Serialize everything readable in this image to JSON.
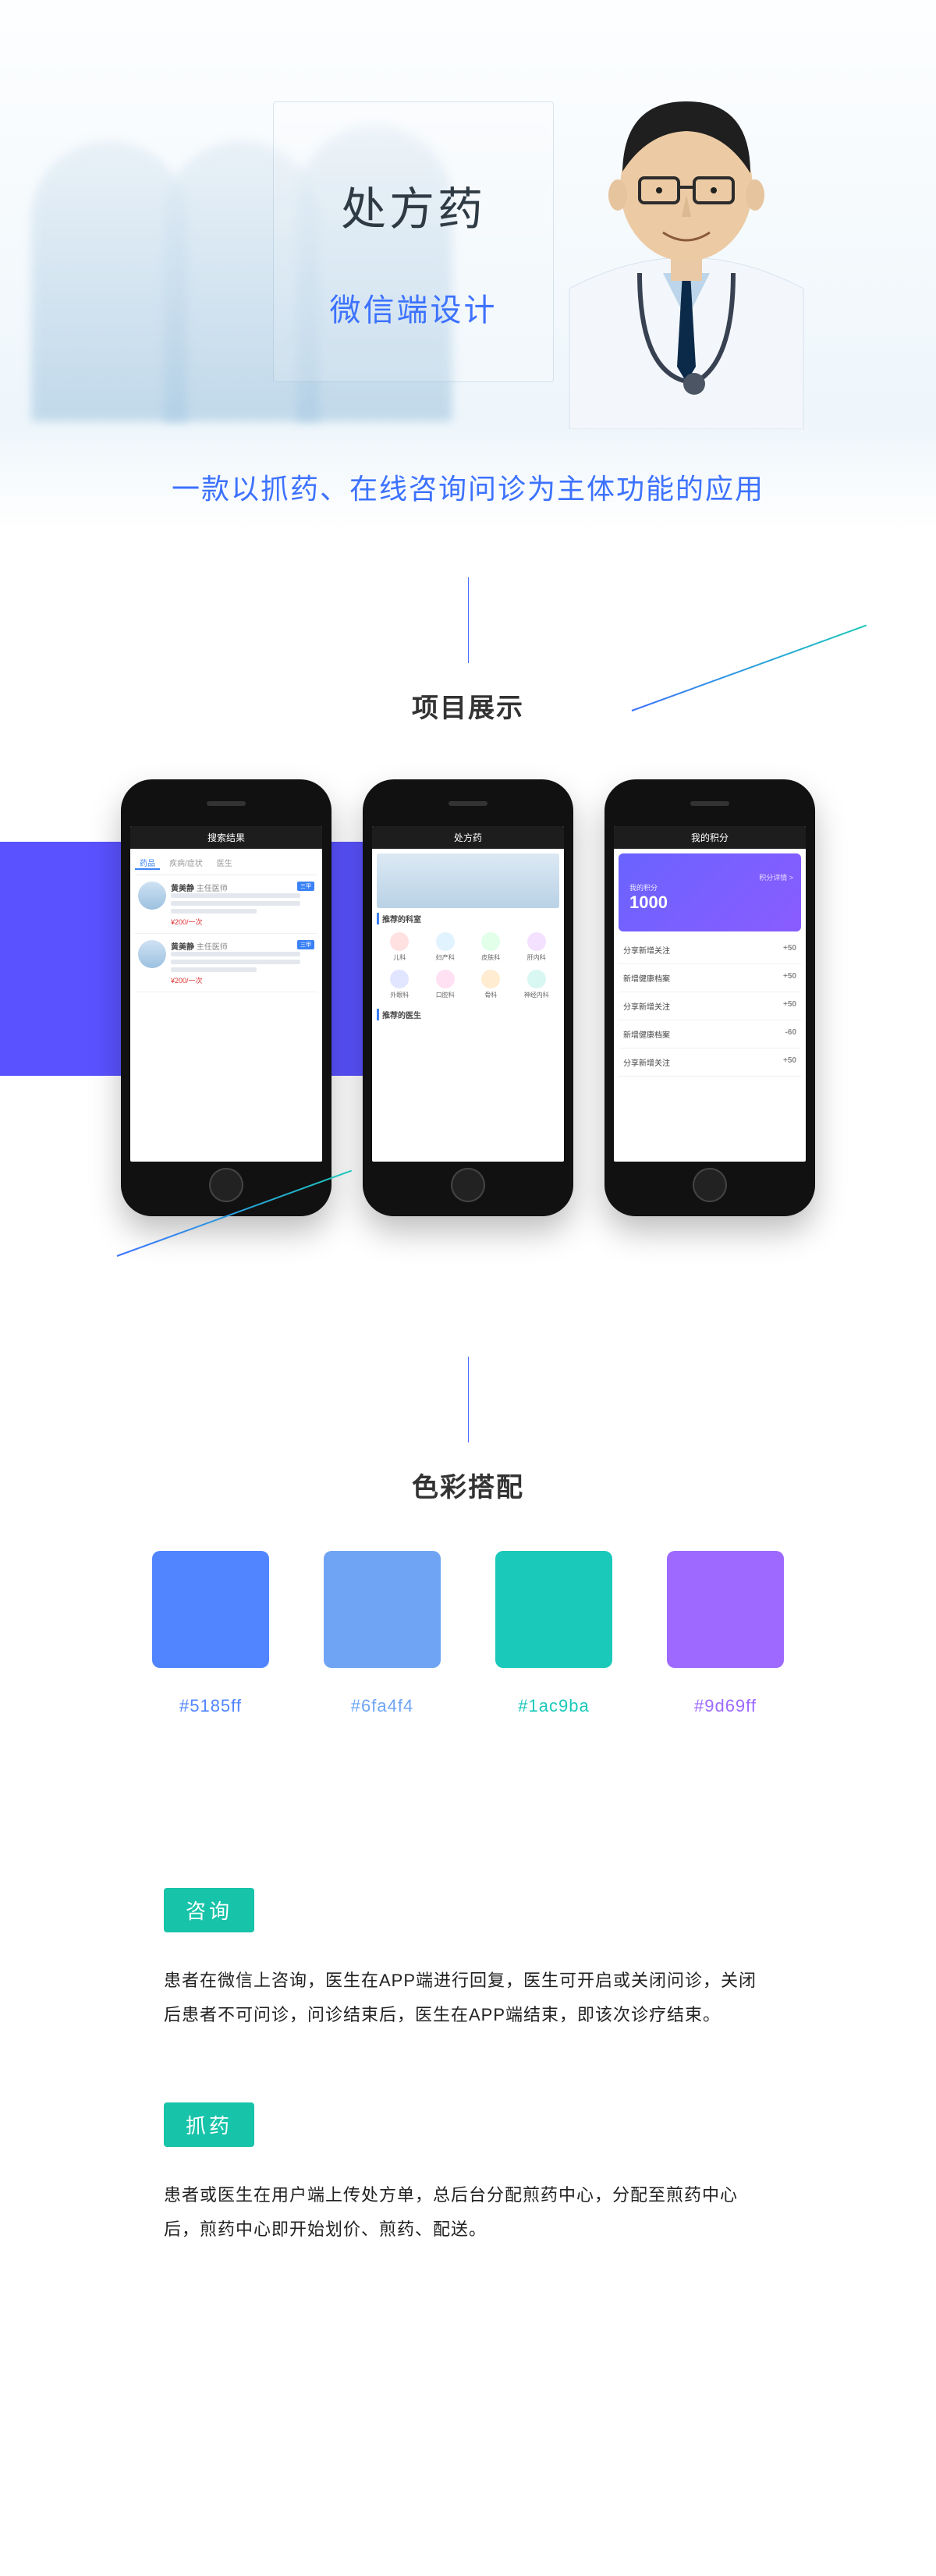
{
  "colors": {
    "blue": "#5185ff",
    "softblue": "#6fa4f4",
    "teal": "#1ac9ba",
    "violet": "#9d69ff",
    "heroTagline": "#3d72ff",
    "bandBg": "#5a52ff"
  },
  "hero": {
    "title": "处方药",
    "subtitle": "微信端设计",
    "tagline": "一款以抓药、在线咨询问诊为主体功能的应用"
  },
  "sections": {
    "showcase": "项目展示",
    "palette": "色彩搭配"
  },
  "phones": {
    "p1": {
      "header": "搜索结果",
      "doctorName": "黄美静",
      "price": "¥200/一次"
    },
    "p2": {
      "header": "处方药",
      "sect1": "推荐的科室",
      "sect2": "推荐的医生",
      "depts": [
        "儿科",
        "妇产科",
        "皮肤科",
        "肝内科",
        "外眼科",
        "口腔科",
        "骨科",
        "神经内科"
      ]
    },
    "p3": {
      "header": "我的积分",
      "scoreLabel": "我的积分",
      "scoreValue": "1000",
      "rows": [
        {
          "t": "分享新增关注",
          "v": "+50"
        },
        {
          "t": "新增健康档案",
          "v": "+50"
        },
        {
          "t": "分享新增关注",
          "v": "+50"
        },
        {
          "t": "新增健康档案",
          "v": "-60"
        },
        {
          "t": "分享新增关注",
          "v": "+50"
        }
      ]
    }
  },
  "swatches": [
    {
      "hex": "#5185ff"
    },
    {
      "hex": "#6fa4f4"
    },
    {
      "hex": "#1ac9ba"
    },
    {
      "hex": "#9d69ff"
    }
  ],
  "features": [
    {
      "tag": "咨询",
      "body": "患者在微信上咨询，医生在APP端进行回复，医生可开启或关闭问诊，关闭后患者不可问诊，问诊结束后，医生在APP端结束，即该次诊疗结束。"
    },
    {
      "tag": "抓药",
      "body": "患者或医生在用户端上传处方单，总后台分配煎药中心，分配至煎药中心后，煎药中心即开始划价、煎药、配送。"
    }
  ]
}
